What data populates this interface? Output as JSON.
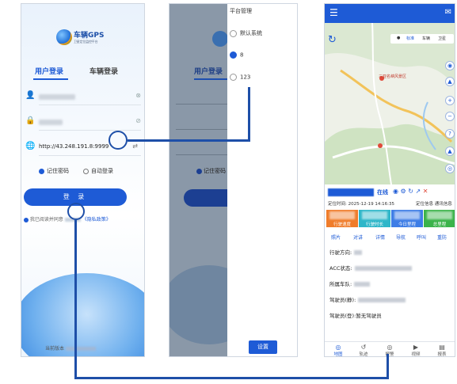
{
  "login_screen": {
    "app_name": "车辆GPS",
    "app_subtitle": "卫星定位监控平台",
    "tab_user": "用户登录",
    "tab_vehicle": "车辆登录",
    "server_url": "http://43.248.191.8:9999",
    "remember_password": "记住密码",
    "auto_login": "自动登录",
    "login_button": "登 录",
    "agreement_text": "我已阅读并同意",
    "privacy_text": "《隐私政策》",
    "version_text": "当前版本"
  },
  "platform_screen": {
    "tab_user": "用户登录",
    "remember_password": "记住密码",
    "drawer_title": "平台管理",
    "options": [
      {
        "label": "默认系统",
        "selected": false
      },
      {
        "label": "8",
        "selected": true
      },
      {
        "label": "123",
        "selected": false
      }
    ],
    "set_button": "设置"
  },
  "vehicle_screen": {
    "map_tab_standard": "标准",
    "map_tab_vehicle": "车辆",
    "map_tab_satellite": "卫星",
    "map_label_district": "三亚名峡风景区",
    "status": "在线",
    "locate_time": "定位时间: 2025-12-19 14:16:35",
    "btn_locate": "定位信息",
    "btn_comm": "通讯信息",
    "stats": [
      {
        "label": "行驶速度",
        "color": "#f07c2a"
      },
      {
        "label": "行驶时长",
        "color": "#2eb6c9"
      },
      {
        "label": "今日里程",
        "color": "#3d7de6"
      },
      {
        "label": "总里程",
        "color": "#3bb34a"
      }
    ],
    "actions": [
      "照片",
      "对讲",
      "详情",
      "导航",
      "呼叫",
      "重防"
    ],
    "details": [
      "行驶方向:",
      "ACC状态:",
      "所属车队:",
      "驾驶员(静):",
      "驾驶员(登):"
    ],
    "driver_login_note": "暂无驾驶员",
    "nav": [
      {
        "label": "地图",
        "icon": "map-pin-icon",
        "active": true
      },
      {
        "label": "轨迹",
        "icon": "track-icon",
        "active": false
      },
      {
        "label": "报警",
        "icon": "alarm-icon",
        "active": false
      },
      {
        "label": "视频",
        "icon": "video-icon",
        "active": false
      },
      {
        "label": "报表",
        "icon": "report-icon",
        "active": false
      }
    ]
  },
  "colors": {
    "accent": "#1e5bd6",
    "connector": "#1e4fa8"
  }
}
